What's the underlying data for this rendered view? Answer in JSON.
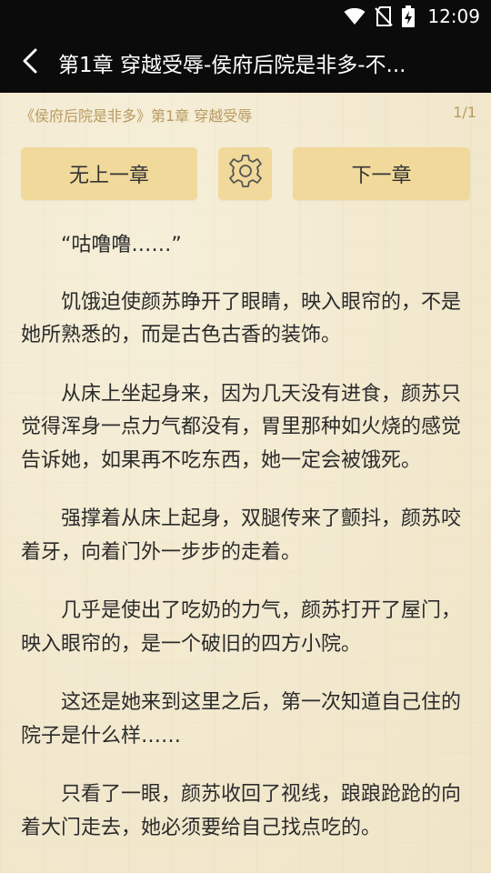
{
  "status_bar": {
    "time": "12:09",
    "icons": [
      "wifi-icon",
      "no-sim-icon",
      "battery-charging-icon"
    ]
  },
  "appbar": {
    "back_icon": "back-arrow-icon",
    "title": "第1章 穿越受辱-侯府后院是非多-不..."
  },
  "reader": {
    "breadcrumb": "《侯府后院是非多》第1章 穿越受辱",
    "page_indicator": "1/1",
    "prev_button": "无上一章",
    "settings_icon": "gear-icon",
    "next_button": "下一章",
    "paragraphs": [
      "“咕噜噜……”",
      "饥饿迫使颜苏睁开了眼睛，映入眼帘的，不是她所熟悉的，而是古色古香的装饰。",
      "从床上坐起身来，因为几天没有进食，颜苏只觉得浑身一点力气都没有，胃里那种如火烧的感觉告诉她，如果再不吃东西，她一定会被饿死。",
      "强撑着从床上起身，双腿传来了颤抖，颜苏咬着牙，向着门外一步步的走着。",
      "几乎是使出了吃奶的力气，颜苏打开了屋门，映入眼帘的，是一个破旧的四方小院。",
      "这还是她来到这里之后，第一次知道自己住的院子是什么样……",
      "只看了一眼，颜苏收回了视线，踉踉跄跄的向着大门走去，她必须要给自己找点吃的。"
    ]
  },
  "colors": {
    "topbar_bg": "#0b0b0b",
    "paper_bg": "#f3ead2",
    "button_bg": "#f0d99a",
    "meta_text": "#b89a60",
    "body_text": "#2b2b2b"
  }
}
